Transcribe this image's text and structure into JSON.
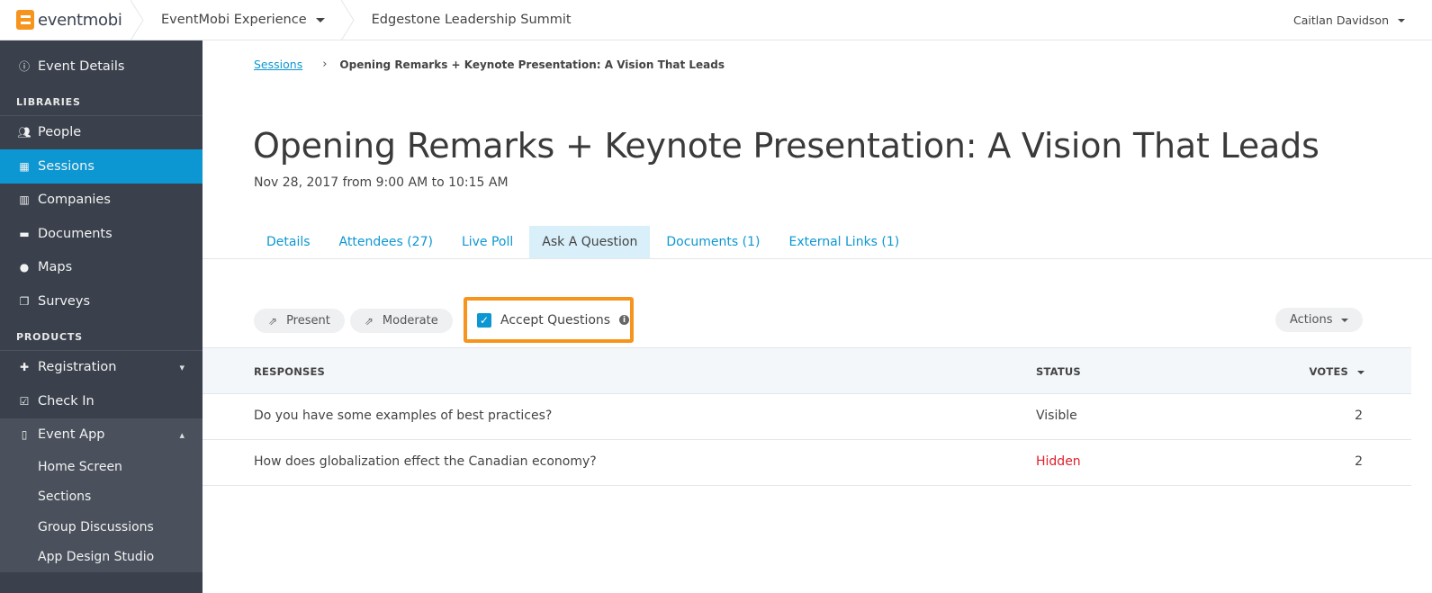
{
  "header": {
    "logo_text": "eventmobi",
    "org": "EventMobi Experience",
    "event": "Edgestone Leadership Summit",
    "user": "Caitlan Davidson"
  },
  "sidebar": {
    "event_details": "Event Details",
    "libraries_heading": "LIBRARIES",
    "libraries": [
      {
        "label": "People",
        "icon": "people-icon"
      },
      {
        "label": "Sessions",
        "icon": "calendar-icon",
        "active": true
      },
      {
        "label": "Companies",
        "icon": "building-icon"
      },
      {
        "label": "Documents",
        "icon": "briefcase-icon"
      },
      {
        "label": "Maps",
        "icon": "map-pin-icon"
      },
      {
        "label": "Surveys",
        "icon": "clipboard-icon"
      }
    ],
    "products_heading": "PRODUCTS",
    "products": [
      {
        "label": "Registration",
        "icon": "user-plus-icon"
      },
      {
        "label": "Check In",
        "icon": "checkbox-icon"
      },
      {
        "label": "Event App",
        "icon": "mobile-icon"
      }
    ],
    "event_app_subitems": [
      "Home Screen",
      "Sections",
      "Group Discussions",
      "App Design Studio"
    ]
  },
  "breadcrumb": {
    "parent": "Sessions",
    "current": "Opening Remarks + Keynote Presentation: A Vision That Leads"
  },
  "page": {
    "title": "Opening Remarks + Keynote Presentation: A Vision That Leads",
    "date": "Nov 28, 2017 from 9:00 AM to 10:15 AM"
  },
  "tabs": [
    "Details",
    "Attendees (27)",
    "Live Poll",
    "Ask A Question",
    "Documents (1)",
    "External Links (1)"
  ],
  "active_tab": "Ask A Question",
  "toolbar": {
    "present": "Present",
    "moderate": "Moderate",
    "accept_questions": "Accept Questions",
    "accept_checked": true,
    "actions": "Actions"
  },
  "table": {
    "headers": {
      "responses": "RESPONSES",
      "status": "STATUS",
      "votes": "VOTES"
    },
    "rows": [
      {
        "response": "Do you have some examples of best practices?",
        "status": "Visible",
        "votes": "2"
      },
      {
        "response": "How does globalization effect the Canadian economy?",
        "status": "Hidden",
        "votes": "2"
      }
    ]
  },
  "colors": {
    "accent": "#0c97d3",
    "sidebar": "#3a414c",
    "highlight": "#f7941d",
    "hidden_status": "#e0202c"
  }
}
